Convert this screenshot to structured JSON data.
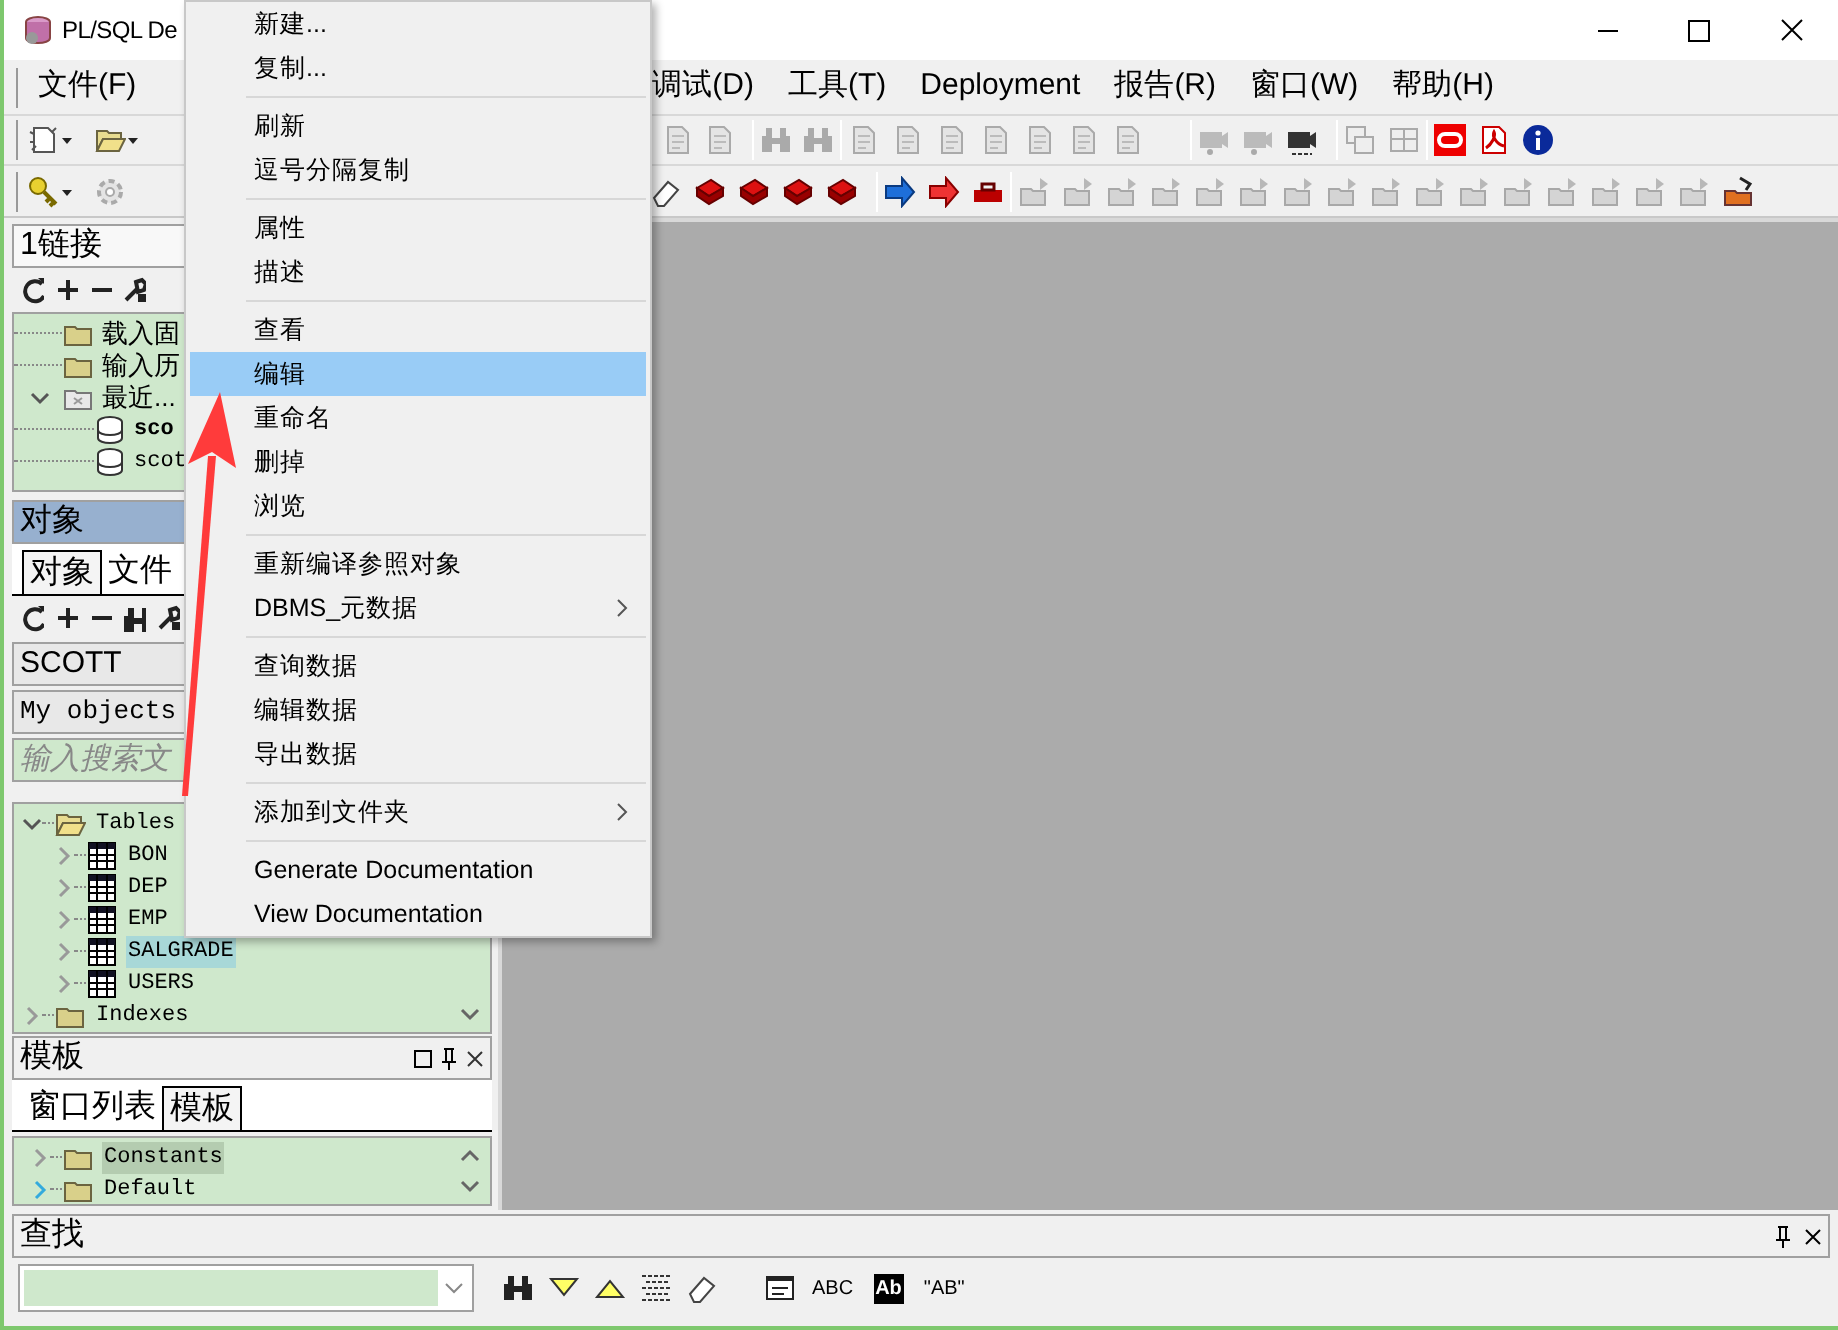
{
  "window": {
    "title": "PL/SQL De"
  },
  "menu_bar": [
    {
      "label": "文件(F)"
    },
    {
      "label": "调试(D)"
    },
    {
      "label": "工具(T)"
    },
    {
      "label": "Deployment"
    },
    {
      "label": "报告(R)"
    },
    {
      "label": "窗口(W)"
    },
    {
      "label": "帮助(H)"
    }
  ],
  "connections_panel": {
    "title": "1链接",
    "tree": [
      {
        "label": "载入固",
        "kind": "folder"
      },
      {
        "label": "输入历",
        "kind": "folder"
      },
      {
        "label": "最近...",
        "kind": "group",
        "expanded": true,
        "children": [
          {
            "label": "sco",
            "kind": "connection",
            "active": true
          },
          {
            "label": "scot",
            "kind": "connection",
            "active": false
          }
        ]
      }
    ]
  },
  "objects_panel": {
    "title": "对象",
    "tabs": [
      {
        "label": "对象",
        "selected": true
      },
      {
        "label": "文件",
        "selected": false
      }
    ],
    "owner": "SCOTT",
    "filter": "My objects",
    "search": {
      "placeholder": "输入搜索文"
    },
    "tree": [
      {
        "label": "Tables",
        "expanded": true,
        "selected": false,
        "children": [
          {
            "label": "BON",
            "expanded": false,
            "selected": false
          },
          {
            "label": "DEP",
            "expanded": false,
            "selected": false
          },
          {
            "label": "EMP",
            "expanded": false,
            "selected": false
          },
          {
            "label": "SALGRADE",
            "expanded": false,
            "selected": true
          },
          {
            "label": "USERS",
            "expanded": false,
            "selected": false
          }
        ]
      },
      {
        "label": "Indexes",
        "expanded": false,
        "selected": false
      }
    ]
  },
  "templates_panel": {
    "title": "模板",
    "tabs": [
      {
        "label": "窗口列表",
        "selected": false
      },
      {
        "label": "模板",
        "selected": true
      }
    ],
    "tree": [
      {
        "label": "Constants",
        "selected": true
      },
      {
        "label": "Default",
        "selected": false
      }
    ]
  },
  "find_panel": {
    "title": "查找",
    "options": [
      "ABC",
      "Ab",
      "\"AB\""
    ]
  },
  "context_menu": {
    "groups": [
      [
        {
          "label": "新建...",
          "selected": false,
          "submenu": false
        },
        {
          "label": "复制...",
          "selected": false,
          "submenu": false
        }
      ],
      [
        {
          "label": "刷新",
          "selected": false,
          "submenu": false
        },
        {
          "label": "逗号分隔复制",
          "selected": false,
          "submenu": false
        }
      ],
      [
        {
          "label": "属性",
          "selected": false,
          "submenu": false
        },
        {
          "label": "描述",
          "selected": false,
          "submenu": false
        }
      ],
      [
        {
          "label": "查看",
          "selected": false,
          "submenu": false
        },
        {
          "label": "编辑",
          "selected": true,
          "submenu": false
        },
        {
          "label": "重命名",
          "selected": false,
          "submenu": false
        },
        {
          "label": "删掉",
          "selected": false,
          "submenu": false
        },
        {
          "label": "浏览",
          "selected": false,
          "submenu": false
        }
      ],
      [
        {
          "label": "重新编译参照对象",
          "selected": false,
          "submenu": false
        },
        {
          "label": "DBMS_元数据",
          "selected": false,
          "submenu": true
        }
      ],
      [
        {
          "label": "查询数据",
          "selected": false,
          "submenu": false
        },
        {
          "label": "编辑数据",
          "selected": false,
          "submenu": false
        },
        {
          "label": "导出数据",
          "selected": false,
          "submenu": false
        }
      ],
      [
        {
          "label": "添加到文件夹",
          "selected": false,
          "submenu": true
        }
      ],
      [
        {
          "label": "Generate Documentation",
          "selected": false,
          "submenu": false
        },
        {
          "label": "View Documentation",
          "selected": false,
          "submenu": false
        }
      ]
    ]
  }
}
